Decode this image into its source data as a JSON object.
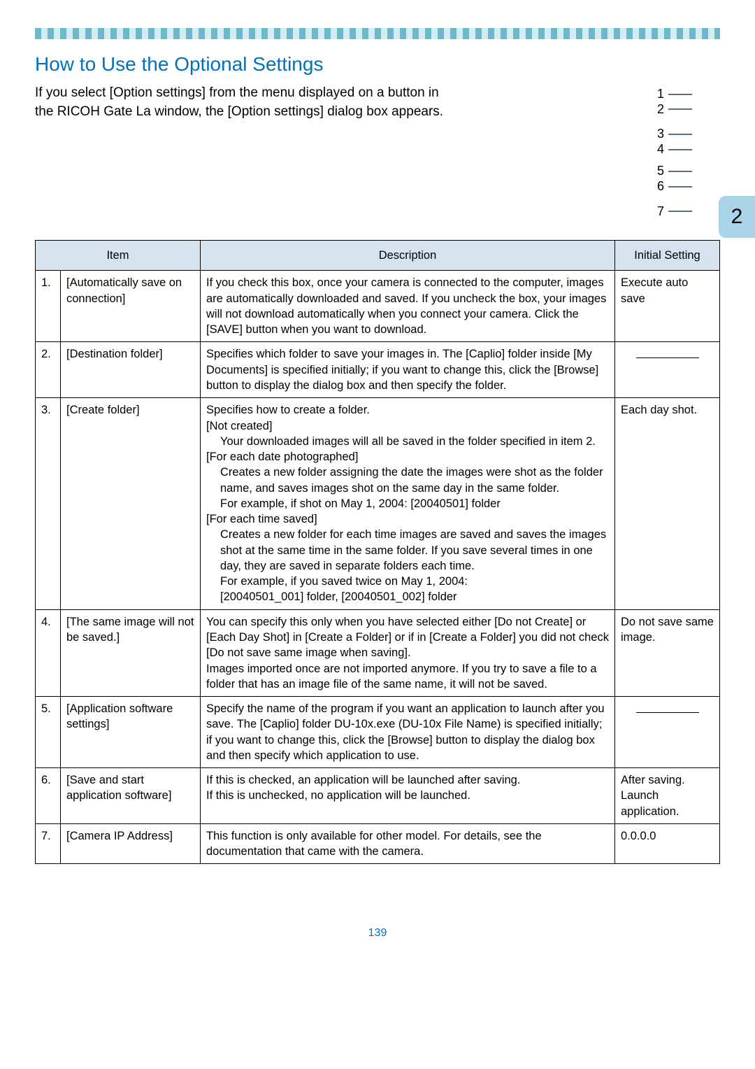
{
  "header": {
    "title": "How to Use the Optional Settings",
    "intro": "If you select [Option settings] from the menu displayed on a button in the RICOH Gate La window, the [Option settings] dialog box appears."
  },
  "side_tab": "2",
  "callouts": [
    [
      "1",
      "2"
    ],
    [
      "3",
      "4"
    ],
    [
      "5",
      "6"
    ],
    [
      "7"
    ]
  ],
  "table": {
    "headers": {
      "item": "Item",
      "description": "Description",
      "initial": "Initial Setting"
    },
    "rows": [
      {
        "num": "1.",
        "item": "[Automatically save on connection]",
        "desc": "If you check this box, once your camera is connected to the computer, images are automatically downloaded and saved. If you uncheck the box, your images will not download automatically when you connect your camera. Click the [SAVE] button when you want to download.",
        "initial": "Execute auto save"
      },
      {
        "num": "2.",
        "item": "[Destination folder]",
        "desc": "Specifies which folder to save your images in. The [Caplio] folder inside [My Documents] is specified initially; if you want to change this, click the [Browse] button to display the dialog box and then specify the folder.",
        "initial_placeholder": true
      },
      {
        "num": "3.",
        "item": "[Create folder]",
        "desc_block": {
          "p0": "Specifies how to create a folder.",
          "p1": "[Not created]",
          "p2": "Your downloaded images will all be saved in the folder specified in item 2.",
          "p3": "[For each date photographed]",
          "p4": "Creates a new folder assigning the date the images were shot as the folder name, and saves images shot on the same day in the same folder.",
          "p5": "For example, if shot on May 1, 2004: [20040501] folder",
          "p6": "[For each time saved]",
          "p7": "Creates a new folder for each time images are saved and saves the images shot at the same time in the same folder. If you save several times in one day, they are saved in separate folders each time.",
          "p8": "For example, if you saved twice on May 1, 2004:",
          "p9": "[20040501_001] folder, [20040501_002] folder"
        },
        "initial": "Each day shot."
      },
      {
        "num": "4.",
        "item": "[The same image will not be saved.]",
        "desc": "You can specify this only when you have selected either [Do not Create] or [Each Day Shot] in [Create a Folder] or if in [Create a Folder] you did not check [Do not save same image when saving].\nImages imported once are not imported anymore. If you try to save a file to a folder that has an image file of the same name, it will not be saved.",
        "initial": "Do not save same image."
      },
      {
        "num": "5.",
        "item": "[Application software settings]",
        "desc": "Specify the name of the program if you want an application to launch after you save. The [Caplio] folder DU-10x.exe (DU-10x File Name) is specified initially; if you want to change this, click the [Browse] button to display the dialog box and then specify which application to use.",
        "initial_placeholder": true
      },
      {
        "num": "6.",
        "item": "[Save and start application software]",
        "desc": "If this is checked, an application will be launched after saving.\nIf this is unchecked, no application will be launched.",
        "initial": "After saving. Launch application."
      },
      {
        "num": "7.",
        "item": "[Camera IP Address]",
        "desc": "This function is only available for other model. For details, see the documentation that came with the camera.",
        "initial": "0.0.0.0"
      }
    ]
  },
  "page_number": "139",
  "chart_data": null
}
